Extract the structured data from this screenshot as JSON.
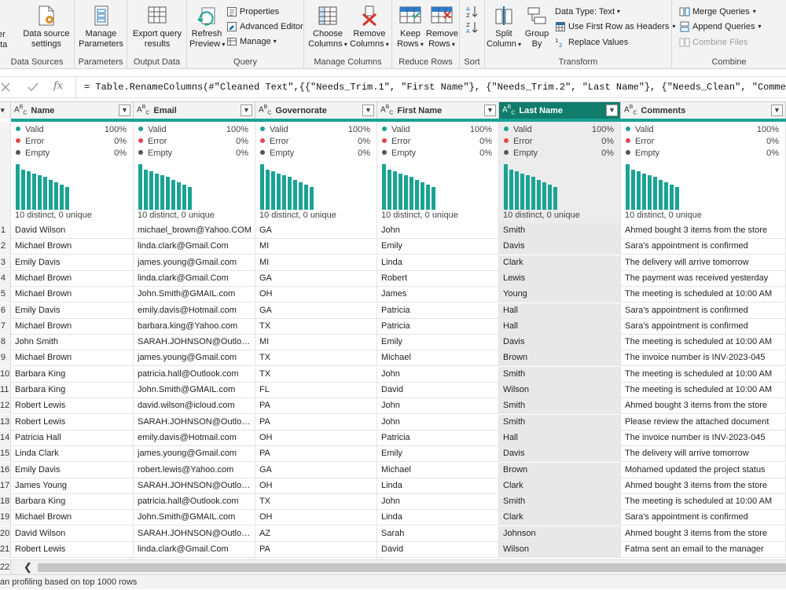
{
  "ribbon": {
    "data_sources": {
      "group_label": "Data Sources",
      "enter_data_partial": "ter\nata",
      "data_source_settings": "Data source\nsettings"
    },
    "parameters": {
      "group_label": "Parameters",
      "manage_parameters": "Manage\nParameters"
    },
    "output": {
      "group_label": "Output Data",
      "export_query_results": "Export query\nresults"
    },
    "query": {
      "group_label": "Query",
      "refresh_preview": "Refresh\nPreview",
      "properties": "Properties",
      "advanced_editor": "Advanced Editor",
      "manage": "Manage"
    },
    "manage_columns": {
      "group_label": "Manage Columns",
      "choose_columns": "Choose\nColumns",
      "remove_columns": "Remove\nColumns"
    },
    "reduce_rows": {
      "group_label": "Reduce Rows",
      "keep_rows": "Keep\nRows",
      "remove_rows": "Remove\nRows"
    },
    "sort": {
      "group_label": "Sort"
    },
    "transform": {
      "group_label": "Transform",
      "split_column": "Split\nColumn",
      "group_by": "Group\nBy",
      "data_type": "Data Type: Text",
      "use_first_row": "Use First Row as Headers",
      "replace_values": "Replace Values"
    },
    "combine": {
      "group_label": "Combine",
      "merge_queries": "Merge Queries",
      "append_queries": "Append Queries",
      "combine_files": "Combine Files"
    }
  },
  "formula": {
    "text": "= Table.RenameColumns(#\"Cleaned Text\",{{\"Needs_Trim.1\", \"First Name\"}, {\"Needs_Trim.2\", \"Last Name\"}, {\"Needs_Clean\", \"Comments\"}, {\"Needs_F",
    "fx_label": "fx"
  },
  "columns": [
    {
      "name": "Name",
      "type": "ABC"
    },
    {
      "name": "Email",
      "type": "ABC"
    },
    {
      "name": "Governorate",
      "type": "ABC"
    },
    {
      "name": "First Name",
      "type": "ABC"
    },
    {
      "name": "Last Name",
      "type": "ABC",
      "selected": true
    },
    {
      "name": "Comments",
      "type": "ABC"
    }
  ],
  "quality": {
    "valid_label": "Valid",
    "error_label": "Error",
    "empty_label": "Empty",
    "valid_pct": "100%",
    "error_pct": "0%",
    "empty_pct": "0%",
    "distinct_text": "10 distinct, 0 unique",
    "colors": {
      "valid": "#1aa394",
      "error": "#e0474c",
      "empty": "#555555"
    },
    "bar_heights": [
      1.0,
      0.88,
      0.84,
      0.8,
      0.76,
      0.72,
      0.66,
      0.6,
      0.56,
      0.5
    ]
  },
  "rows": [
    [
      "1",
      "David Wilson",
      "michael_brown@Yahoo.COM",
      "GA",
      "John",
      "Smith",
      "Ahmed bought 3 items from the store"
    ],
    [
      "2",
      "Michael Brown",
      "linda.clark@Gmail.Com",
      "MI",
      "Emily",
      "Davis",
      "Sara's appointment is confirmed"
    ],
    [
      "3",
      "Emily Davis",
      "james.young@Gmail.com",
      "MI",
      "Linda",
      "Clark",
      "The delivery will arrive tomorrow"
    ],
    [
      "4",
      "Michael Brown",
      "linda.clark@Gmail.Com",
      "GA",
      "Robert",
      "Lewis",
      "The payment was received yesterday"
    ],
    [
      "5",
      "Michael Brown",
      "John.Smith@GMAIL.com",
      "OH",
      "James",
      "Young",
      "The meeting is scheduled at 10:00 AM"
    ],
    [
      "6",
      "Emily Davis",
      "emily.davis@Hotmail.com",
      "GA",
      "Patricia",
      "Hall",
      "Sara's appointment is confirmed"
    ],
    [
      "7",
      "Michael Brown",
      "barbara.king@Yahoo.com",
      "TX",
      "Patricia",
      "Hall",
      "Sara's appointment is confirmed"
    ],
    [
      "8",
      "John Smith",
      "SARAH.JOHNSON@Outlook.C...",
      "MI",
      "Emily",
      "Davis",
      "The meeting is scheduled at 10:00 AM"
    ],
    [
      "9",
      "Michael Brown",
      "james.young@Gmail.com",
      "TX",
      "Michael",
      "Brown",
      "The invoice number is INV-2023-045"
    ],
    [
      "10",
      "Barbara King",
      "patricia.hall@Outlook.com",
      "TX",
      "John",
      "Smith",
      "The meeting is scheduled at 10:00 AM"
    ],
    [
      "11",
      "Barbara King",
      "John.Smith@GMAIL.com",
      "FL",
      "David",
      "Wilson",
      "The meeting is scheduled at 10:00 AM"
    ],
    [
      "12",
      "Robert Lewis",
      "david.wilson@icloud.com",
      "PA",
      "John",
      "Smith",
      "Ahmed bought 3 items from the store"
    ],
    [
      "13",
      "Robert Lewis",
      "SARAH.JOHNSON@Outlook.C...",
      "PA",
      "John",
      "Smith",
      "Please review the attached document"
    ],
    [
      "14",
      "Patricia Hall",
      "emily.davis@Hotmail.com",
      "OH",
      "Patricia",
      "Hall",
      "The invoice number is INV-2023-045"
    ],
    [
      "15",
      "Linda Clark",
      "james.young@Gmail.com",
      "PA",
      "Emily",
      "Davis",
      "The delivery will arrive tomorrow"
    ],
    [
      "16",
      "Emily Davis",
      "robert.lewis@Yahoo.com",
      "GA",
      "Michael",
      "Brown",
      "Mohamed updated the project status"
    ],
    [
      "17",
      "James Young",
      "SARAH.JOHNSON@Outlook.C...",
      "OH",
      "Linda",
      "Clark",
      "Ahmed bought 3 items from the store"
    ],
    [
      "18",
      "Barbara King",
      "patricia.hall@Outlook.com",
      "TX",
      "John",
      "Smith",
      "The meeting is scheduled at 10:00 AM"
    ],
    [
      "19",
      "Michael Brown",
      "John.Smith@GMAIL.com",
      "OH",
      "Linda",
      "Clark",
      "Sara's appointment is confirmed"
    ],
    [
      "20",
      "David Wilson",
      "SARAH.JOHNSON@Outlook.C...",
      "AZ",
      "Sarah",
      "Johnson",
      "Ahmed bought 3 items from the store"
    ],
    [
      "21",
      "Robert Lewis",
      "linda.clark@Gmail.Com",
      "PA",
      "David",
      "Wilson",
      "Fatma sent an email to the manager"
    ]
  ],
  "partial_row_number": "22",
  "status": {
    "text": "an profiling based on top 1000 rows"
  }
}
